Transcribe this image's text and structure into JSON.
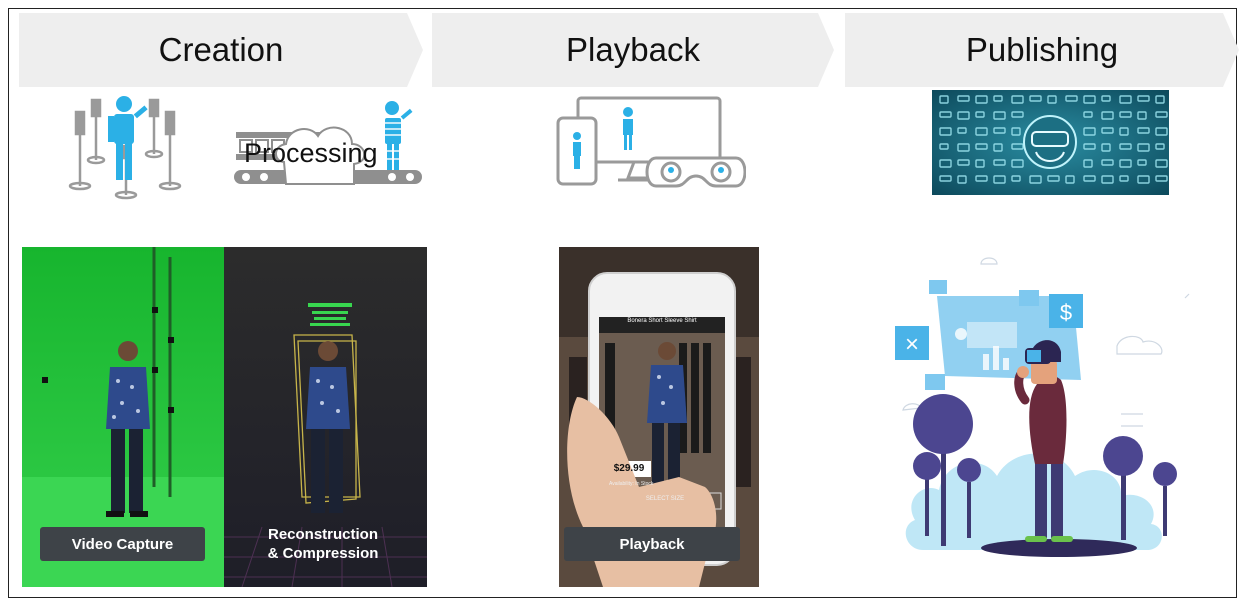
{
  "stages": [
    {
      "title": "Creation"
    },
    {
      "title": "Playback"
    },
    {
      "title": "Publishing"
    }
  ],
  "icons": {
    "processing_label": "Processing"
  },
  "photos": {
    "capture_label": "Video Capture",
    "reconstruction_line1": "Reconstruction",
    "reconstruction_line2": "& Compression",
    "playback_label": "Playback",
    "product_title": "Bonera Short Sleeve Shirt",
    "price": "$29.99",
    "availability": "Availability: In Stock",
    "select_size": "SELECT SIZE",
    "dollar_sign": "$",
    "close_x": "×"
  },
  "colors": {
    "chevron_bg": "#eeeeee",
    "capture_green": "#22c43a",
    "accent_blue": "#2bb0e6",
    "label_bg": "#3e4348"
  }
}
